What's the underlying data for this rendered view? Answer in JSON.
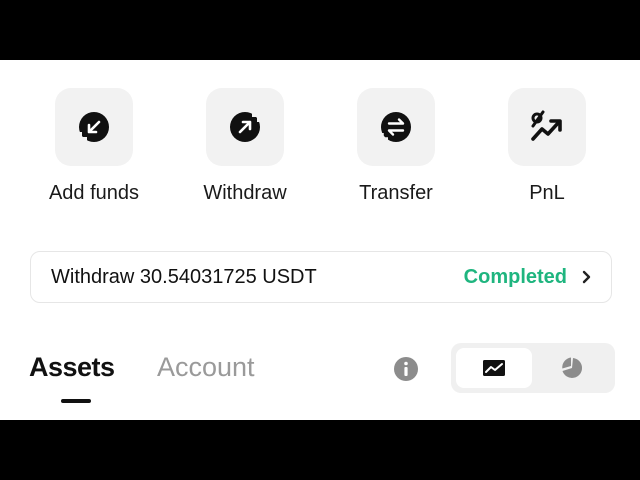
{
  "actions": [
    {
      "label": "Add funds",
      "icon": "add-funds-icon"
    },
    {
      "label": "Withdraw",
      "icon": "withdraw-icon"
    },
    {
      "label": "Transfer",
      "icon": "transfer-icon"
    },
    {
      "label": "PnL",
      "icon": "pnl-icon"
    }
  ],
  "status_card": {
    "description": "Withdraw 30.54031725 USDT",
    "status": "Completed",
    "status_color": "#1fb57f",
    "chevron_icon": "chevron-right-icon"
  },
  "tabs": {
    "assets": "Assets",
    "account": "Account",
    "active": "Assets"
  },
  "toolbar": {
    "info_icon": "info-icon",
    "view_toggle": {
      "options": [
        "trend-chart-icon",
        "pie-chart-icon"
      ],
      "active": "trend-chart-icon"
    }
  }
}
